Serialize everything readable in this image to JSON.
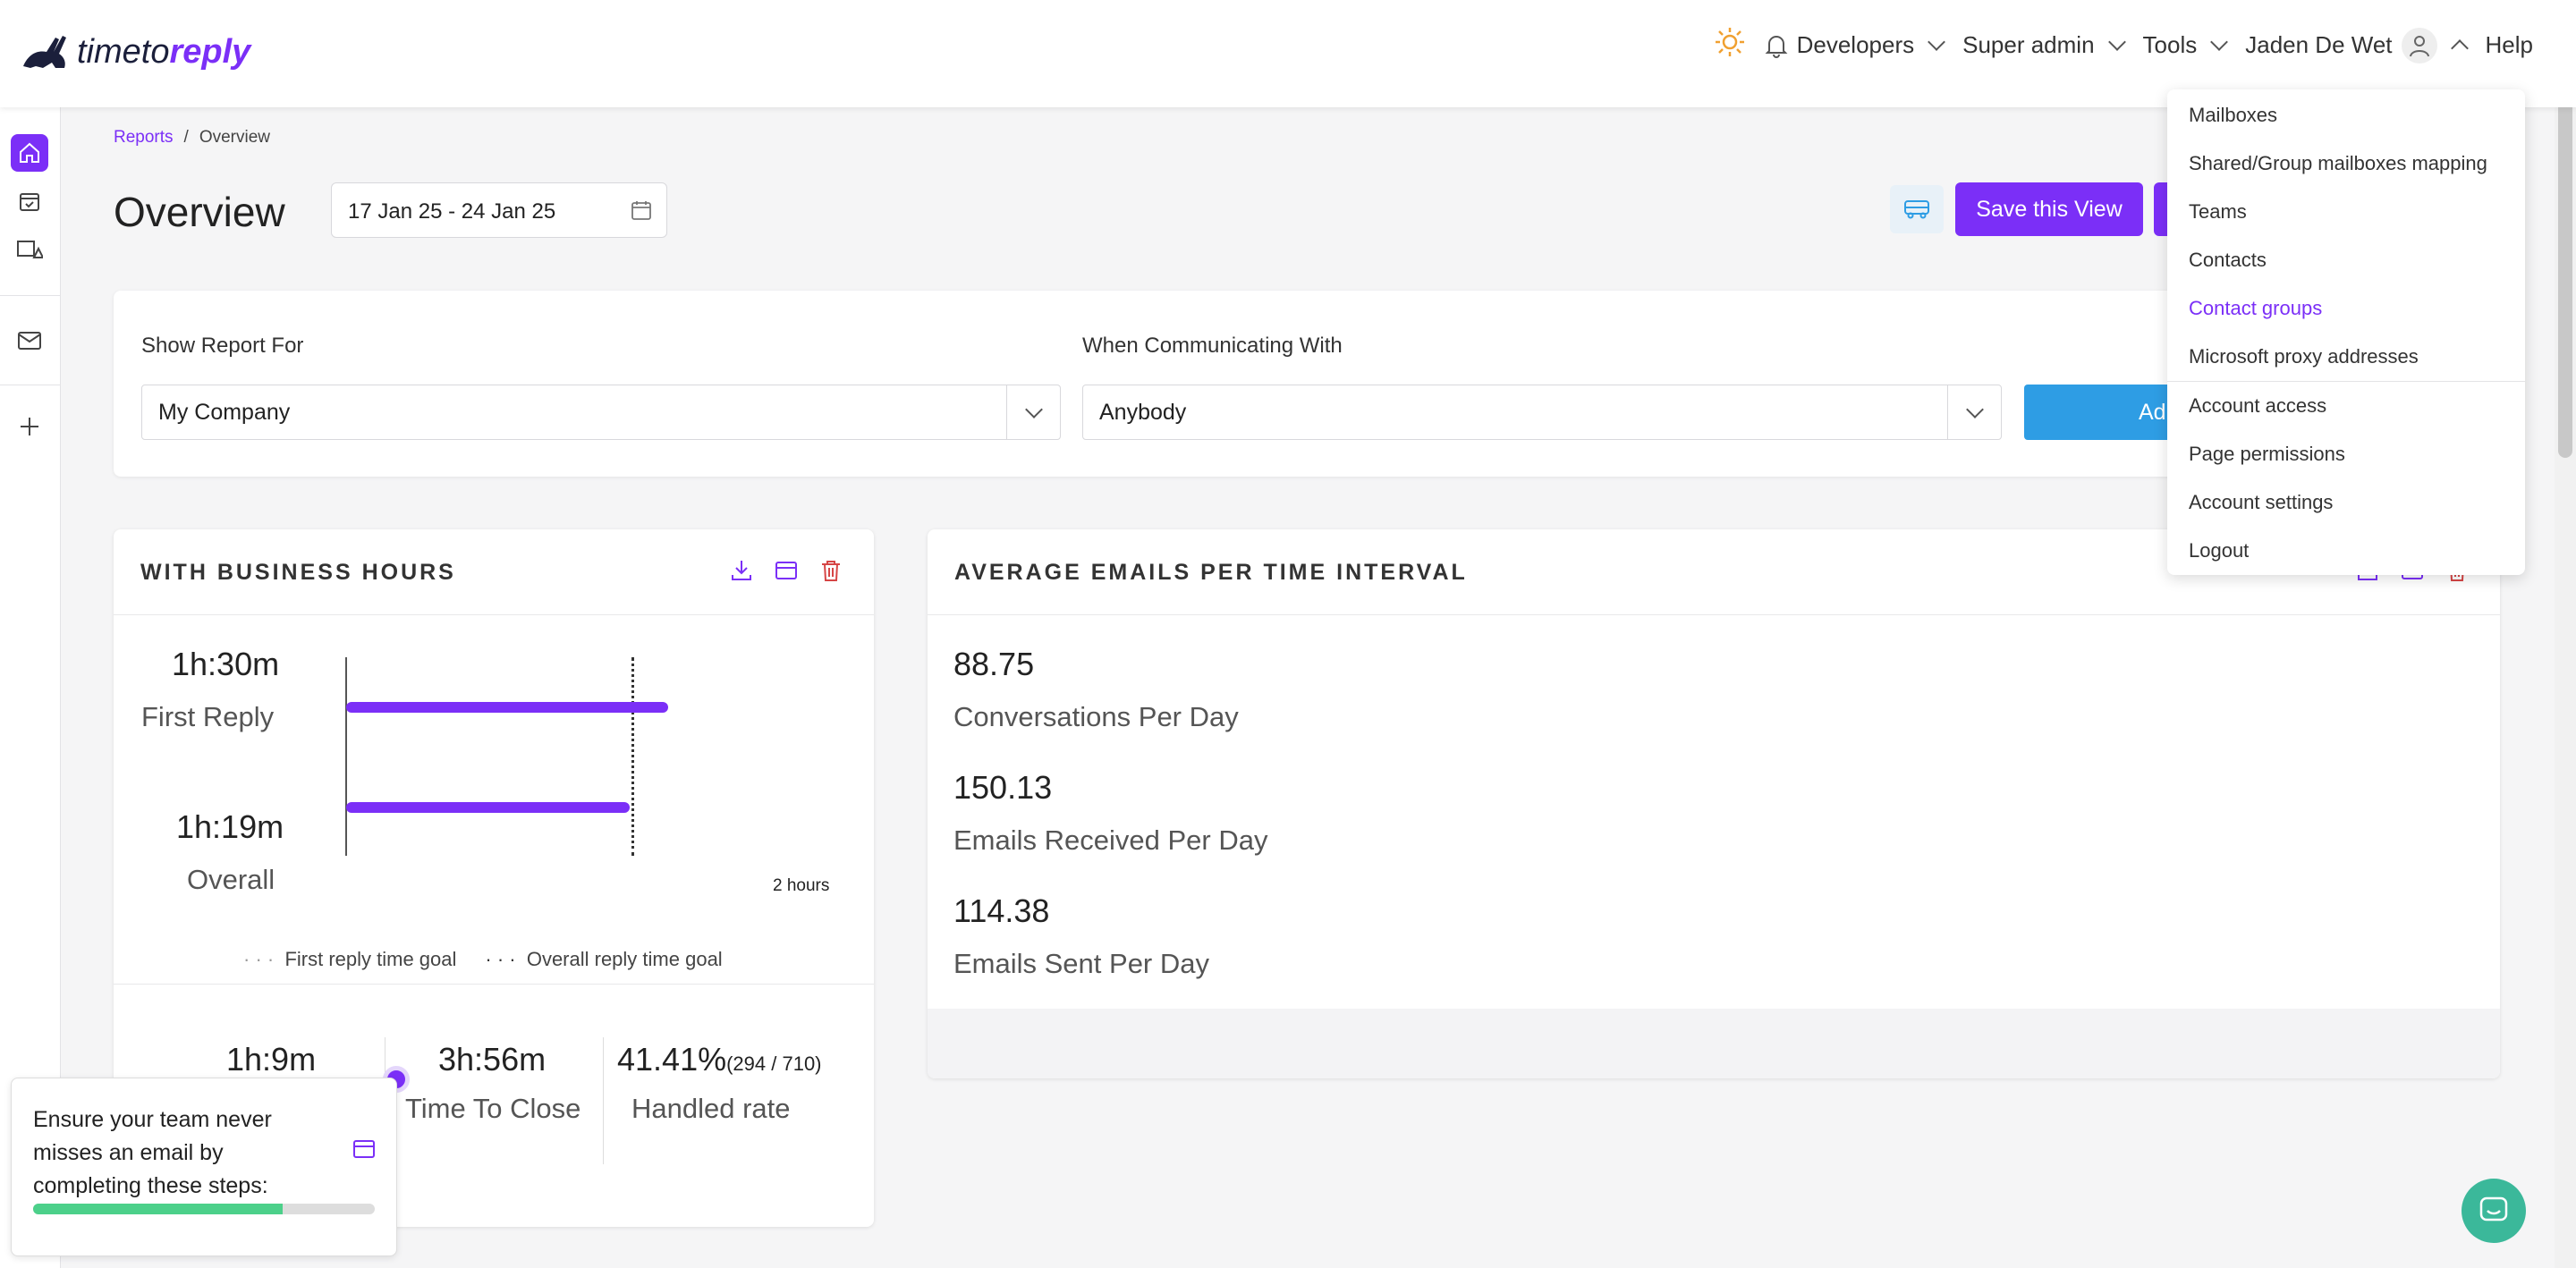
{
  "logo": {
    "text_plain": "timeto",
    "text_bold": "reply"
  },
  "topnav": {
    "developers": "Developers",
    "super_admin": "Super admin",
    "tools": "Tools",
    "user": "Jaden De Wet",
    "help": "Help"
  },
  "breadcrumb": {
    "root": "Reports",
    "separator": "/",
    "current": "Overview"
  },
  "page": {
    "title": "Overview",
    "date_range": "17 Jan 25 - 24 Jan 25",
    "save_view": "Save this View"
  },
  "filters": {
    "report_for_label": "Show Report For",
    "report_for_value": "My Company",
    "communicating_label": "When Communicating With",
    "communicating_value": "Anybody",
    "add_label": "Ad"
  },
  "business_hours": {
    "title": "WITH BUSINESS HOURS",
    "first_reply_value": "1h:30m",
    "first_reply_label": "First Reply",
    "overall_value": "1h:19m",
    "overall_label": "Overall",
    "axis_label": "2 hours",
    "legend_first": "First reply time goal",
    "legend_overall": "Overall reply time goal",
    "time_to_first": "1h:9m",
    "time_to_close_value": "3h:56m",
    "time_to_close_label": "Time To Close",
    "handled_rate_value": "41.41%",
    "handled_rate_detail": "(294 / 710)",
    "handled_rate_label": "Handled rate",
    "chart": {
      "max_hours": 2,
      "goal_hours": 1.33,
      "first_reply_hours": 1.5,
      "overall_hours": 1.32
    }
  },
  "avg_emails": {
    "title": "AVERAGE EMAILS PER TIME INTERVAL",
    "conversations_value": "88.75",
    "conversations_label": "Conversations Per Day",
    "received_value": "150.13",
    "received_label": "Emails Received Per Day",
    "sent_value": "114.38",
    "sent_label": "Emails Sent Per Day"
  },
  "menu": {
    "items": [
      "Mailboxes",
      "Shared/Group mailboxes mapping",
      "Teams",
      "Contacts",
      "Contact groups",
      "Microsoft proxy addresses",
      "Account access",
      "Page permissions",
      "Account settings",
      "Logout"
    ],
    "active_index": 4
  },
  "onboarding": {
    "text": "Ensure your team never misses an email by completing these steps:",
    "progress": 0.73
  },
  "colors": {
    "accent": "#7b2ff7",
    "blue": "#2e9de4",
    "green": "#4cd08a",
    "danger": "#d64545"
  }
}
